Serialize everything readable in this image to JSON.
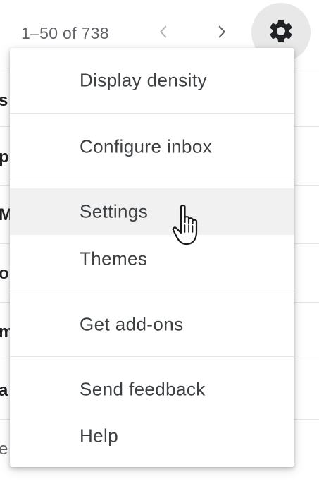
{
  "toolbar": {
    "pager_text": "1–50 of 738",
    "prev_icon": "chevron-left-icon",
    "next_icon": "chevron-right-icon",
    "settings_icon": "gear-icon"
  },
  "email_list": {
    "rows": [
      {
        "sender": "s"
      },
      {
        "sender": "p"
      },
      {
        "sender": "M"
      },
      {
        "sender": "o"
      },
      {
        "sender": "m"
      },
      {
        "sender": "a"
      },
      {
        "sender": "e"
      }
    ]
  },
  "settings_menu": {
    "items": [
      {
        "label": "Display density"
      },
      {
        "label": "Configure inbox"
      },
      {
        "label": "Settings"
      },
      {
        "label": "Themes"
      },
      {
        "label": "Get add-ons"
      },
      {
        "label": "Send feedback"
      },
      {
        "label": "Help"
      }
    ],
    "hovered_item": "Settings"
  },
  "cursor": {
    "icon": "hand-pointer-icon"
  },
  "colors": {
    "menu_text": "#3c4043",
    "pager_text": "#5f6368",
    "hover_bg": "#f1f1f1",
    "gear_bg": "#e8e8e8",
    "divider": "#e6e6e6"
  }
}
